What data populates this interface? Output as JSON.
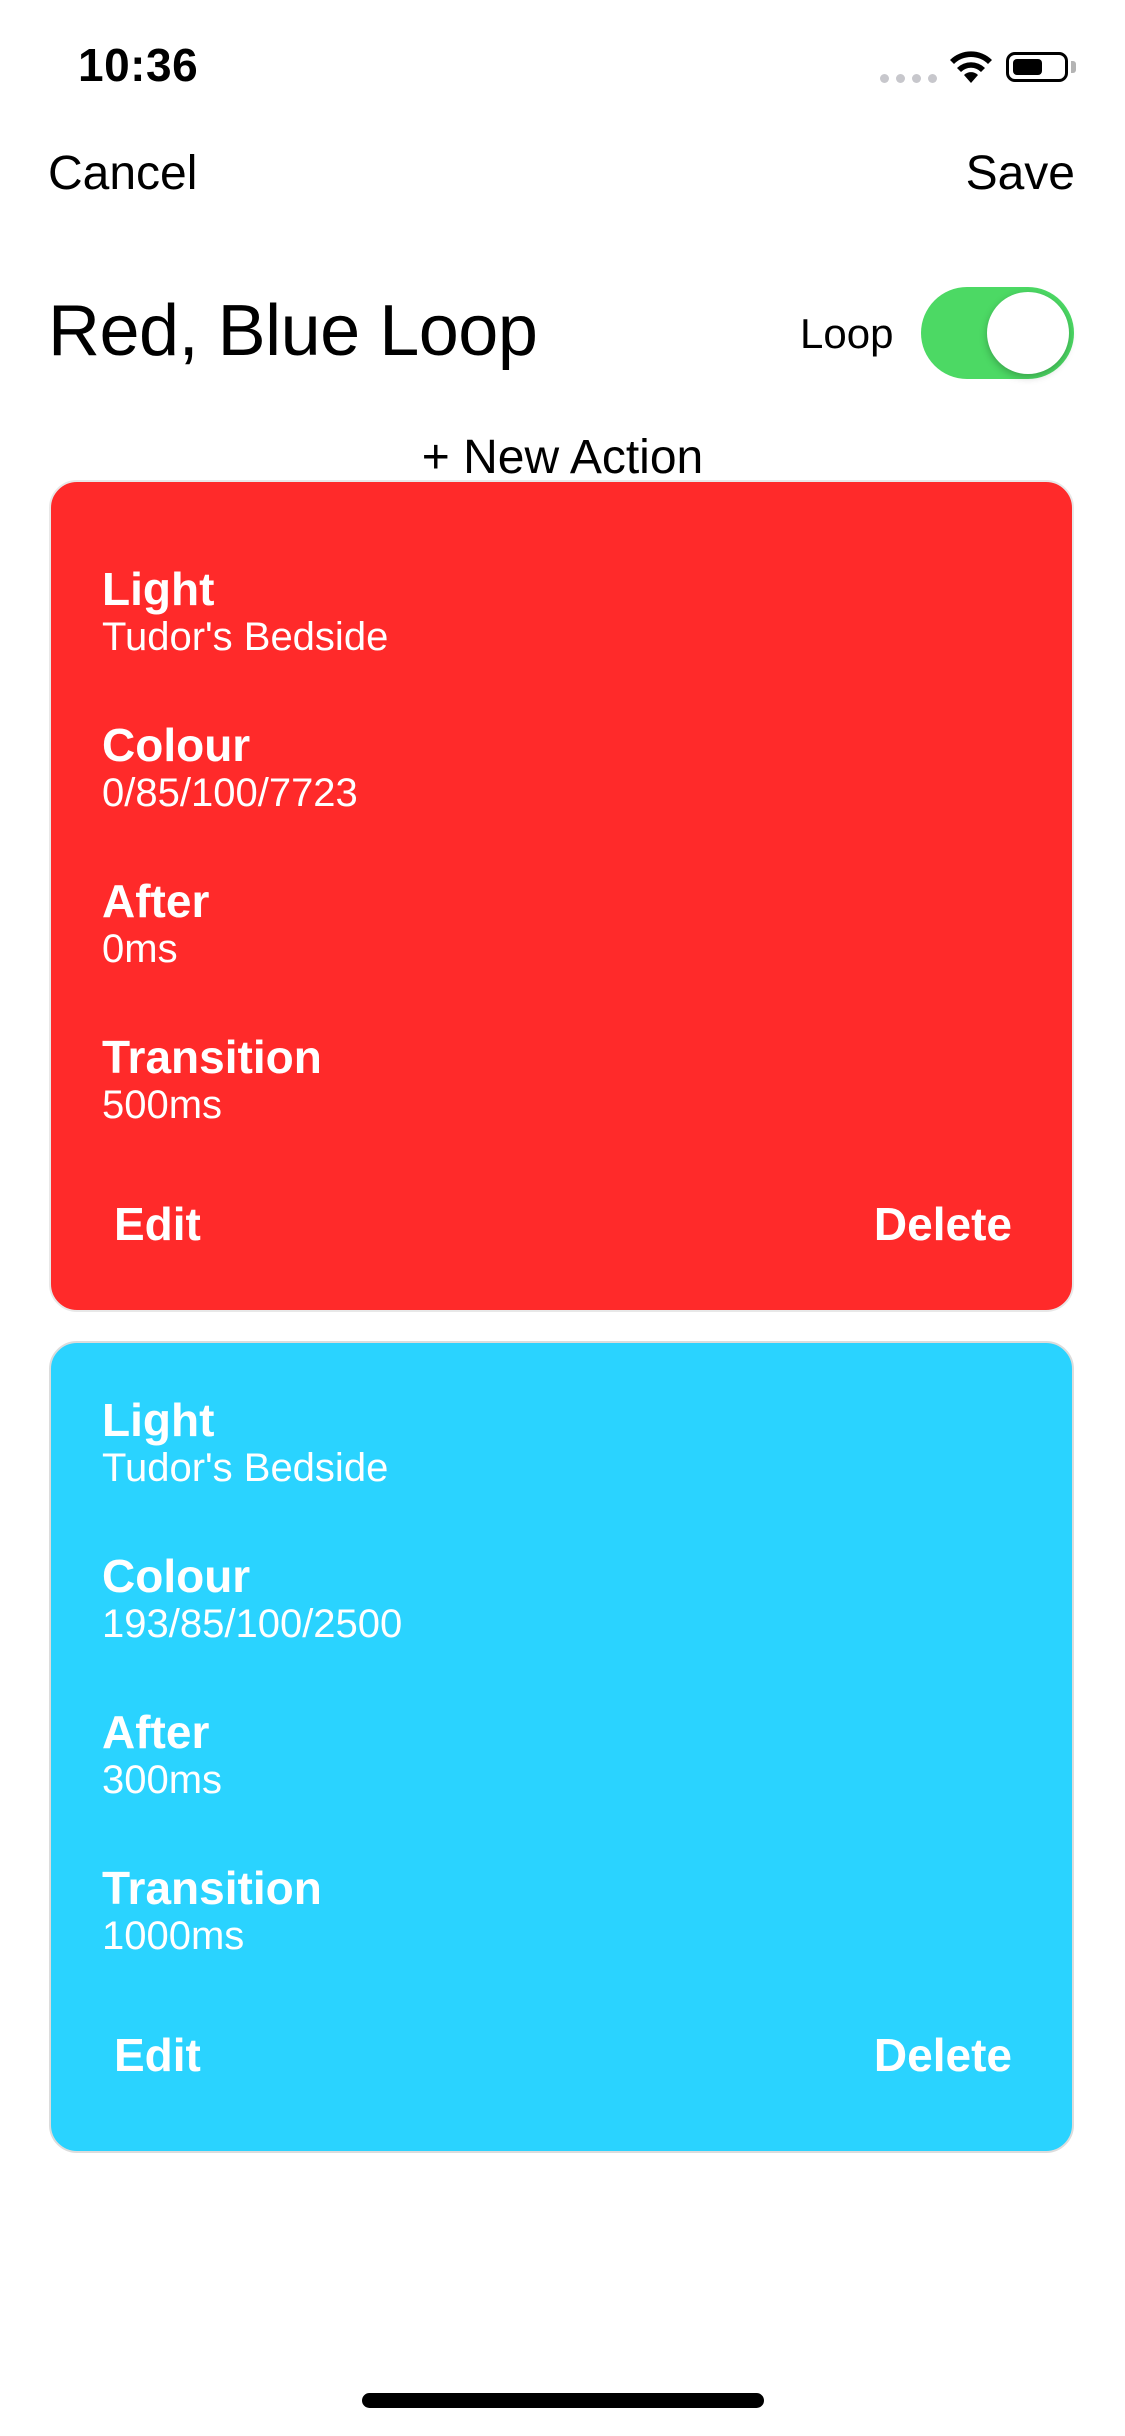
{
  "status_bar": {
    "time": "10:36"
  },
  "nav": {
    "cancel_label": "Cancel",
    "save_label": "Save"
  },
  "header": {
    "title": "Red, Blue Loop",
    "loop_label": "Loop",
    "loop_enabled": true
  },
  "new_action_label": "+ New Action",
  "actions": [
    {
      "color": "#ff2a2a",
      "fields": [
        {
          "label": "Light",
          "value": "Tudor's Bedside"
        },
        {
          "label": "Colour",
          "value": "0/85/100/7723"
        },
        {
          "label": "After",
          "value": "0ms"
        },
        {
          "label": "Transition",
          "value": "500ms"
        }
      ],
      "edit_label": "Edit",
      "delete_label": "Delete"
    },
    {
      "color": "#2ad3ff",
      "fields": [
        {
          "label": "Light",
          "value": "Tudor's Bedside"
        },
        {
          "label": "Colour",
          "value": "193/85/100/2500"
        },
        {
          "label": "After",
          "value": "300ms"
        },
        {
          "label": "Transition",
          "value": "1000ms"
        }
      ],
      "edit_label": "Edit",
      "delete_label": "Delete"
    }
  ],
  "icons": {
    "wifi": "wifi-icon",
    "battery": "battery-icon",
    "signal": "cellular-signal-icon"
  },
  "battery_level": 0.6
}
